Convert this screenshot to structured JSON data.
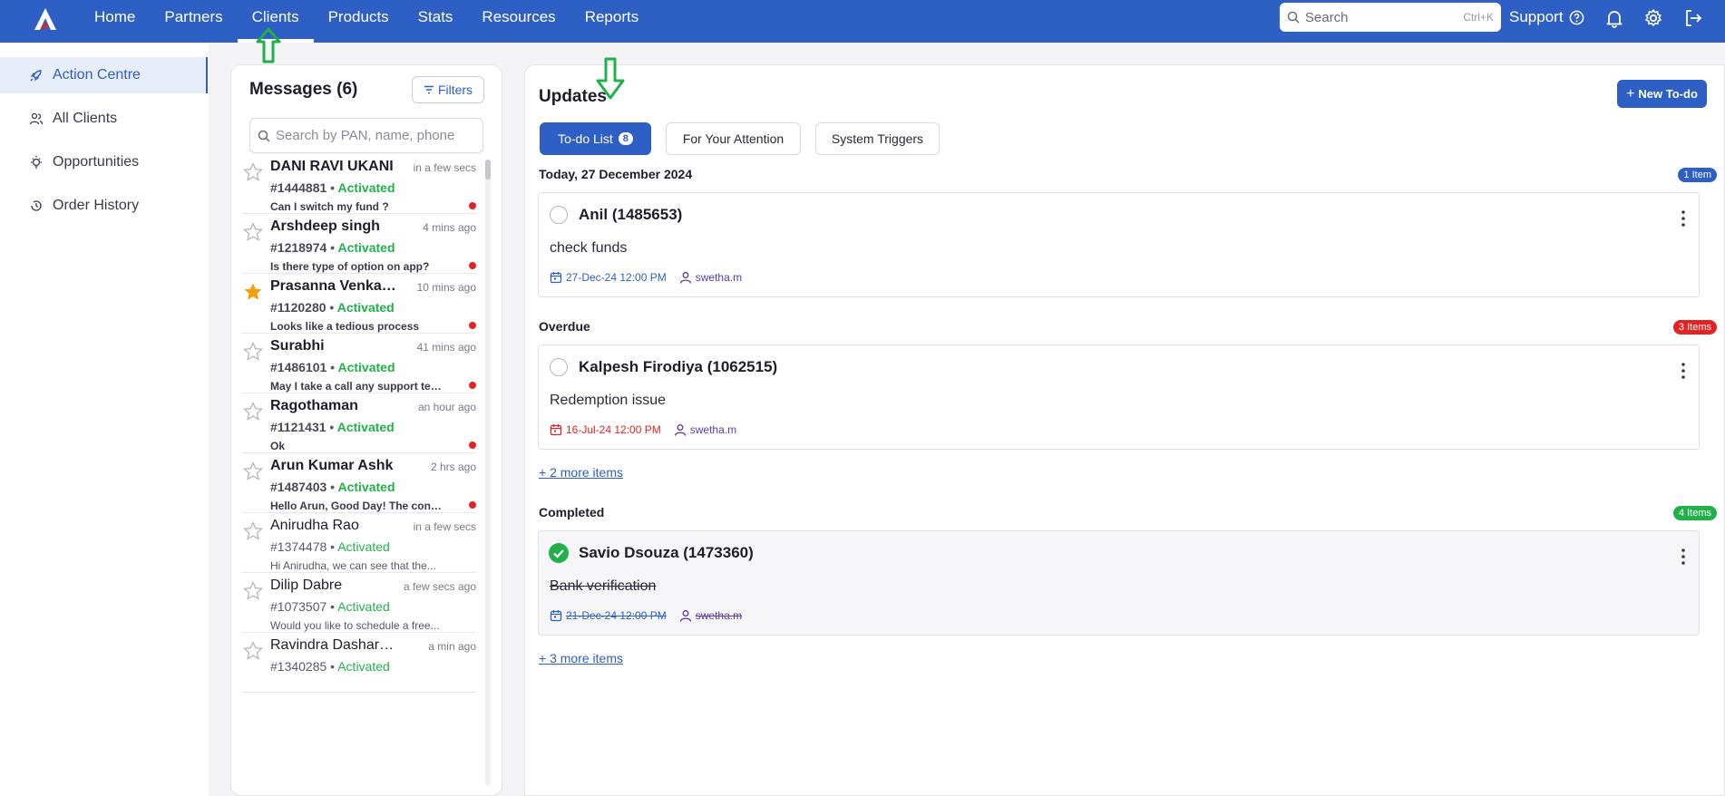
{
  "nav": {
    "items": [
      "Home",
      "Partners",
      "Clients",
      "Products",
      "Stats",
      "Resources",
      "Reports"
    ],
    "active": "Clients",
    "search_placeholder": "Search",
    "search_shortcut": "Ctrl+K",
    "support_label": "Support"
  },
  "sidebar": {
    "items": [
      {
        "label": "Action Centre",
        "icon": "rocket-icon",
        "active": true
      },
      {
        "label": "All Clients",
        "icon": "users-icon",
        "active": false
      },
      {
        "label": "Opportunities",
        "icon": "bulb-icon",
        "active": false
      },
      {
        "label": "Order History",
        "icon": "history-icon",
        "active": false
      }
    ]
  },
  "messages": {
    "title": "Messages (6)",
    "filters_label": "Filters",
    "search_placeholder": "Search by PAN, name, phone",
    "items": [
      {
        "name": "DANI RAVI UKANI",
        "time": "in a few secs",
        "id": "#1444881",
        "status": "Activated",
        "preview": "Can I switch my fund ?",
        "starred": false,
        "unread": true
      },
      {
        "name": "Arshdeep singh",
        "time": "4 mins ago",
        "id": "#1218974",
        "status": "Activated",
        "preview": "Is there type of option on app?",
        "starred": false,
        "unread": true
      },
      {
        "name": "Prasanna Venkatesh",
        "time": "10 mins ago",
        "id": "#1120280",
        "status": "Activated",
        "preview": "Looks like a tedious process",
        "starred": true,
        "unread": true
      },
      {
        "name": "Surabhi",
        "time": "41 mins ago",
        "id": "#1486101",
        "status": "Activated",
        "preview": "May I take a call any support team?",
        "starred": false,
        "unread": true
      },
      {
        "name": "Ragothaman",
        "time": "an hour ago",
        "id": "#1121431",
        "status": "Activated",
        "preview": "Ok",
        "starred": false,
        "unread": true
      },
      {
        "name": "Arun Kumar Ashk",
        "time": "2 hrs ago",
        "id": "#1487403",
        "status": "Activated",
        "preview": "Hello Arun, Good Day! The concern...",
        "starred": false,
        "unread": true
      },
      {
        "name": "Anirudha Rao",
        "time": "in a few secs",
        "id": "#1374478",
        "status": "Activated",
        "preview": "Hi Anirudha, we can see that the...",
        "starred": false,
        "unread": false
      },
      {
        "name": "Dilip Dabre",
        "time": "a few secs ago",
        "id": "#1073507",
        "status": "Activated",
        "preview": "Would you like to schedule a free...",
        "starred": false,
        "unread": false
      },
      {
        "name": "Ravindra Dasharathi",
        "time": "a min ago",
        "id": "#1340285",
        "status": "Activated",
        "preview": "",
        "starred": false,
        "unread": false
      }
    ]
  },
  "updates": {
    "title": "Updates",
    "new_todo_label": "New To-do",
    "tabs": [
      {
        "label": "To-do List",
        "count": "8",
        "active": true
      },
      {
        "label": "For Your Attention",
        "active": false
      },
      {
        "label": "System Triggers",
        "active": false
      }
    ],
    "sections": [
      {
        "heading": "Today, 27 December 2024",
        "badge": "1 Item",
        "badge_color": "#2d5fc4",
        "card": {
          "title": "Anil (1485653)",
          "text": "check funds",
          "date": "27-Dec-24 12:00 PM",
          "user": "swetha.m",
          "state": "open"
        },
        "more": ""
      },
      {
        "heading": "Overdue",
        "badge": "3 Items",
        "badge_color": "#e02424",
        "card": {
          "title": "Kalpesh Firodiya (1062515)",
          "text": "Redemption issue",
          "date": "16-Jul-24 12:00 PM",
          "user": "swetha.m",
          "state": "overdue"
        },
        "more": "+ 2 more items"
      },
      {
        "heading": "Completed",
        "badge": "4 Items",
        "badge_color": "#22b04b",
        "card": {
          "title": "Savio Dsouza (1473360)",
          "text": "Bank verification",
          "date": "21-Dec-24 12:00 PM",
          "user": "swetha.m",
          "state": "done"
        },
        "more": "+ 3 more items"
      }
    ]
  },
  "colors": {
    "brand": "#2d5fc4",
    "activated": "#22b04b",
    "alert": "#e02424",
    "star": "#f59e0b",
    "annotation_arrow": "#22b04b"
  }
}
